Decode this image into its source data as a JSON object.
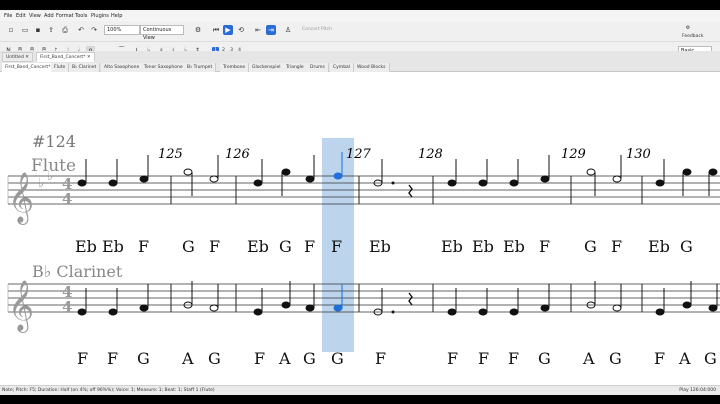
{
  "menu": [
    "File",
    "Edit",
    "View",
    "Add",
    "Format",
    "Tools",
    "Plugins",
    "Help"
  ],
  "toolbar": {
    "zoom_value": "100%",
    "view_mode": "Continuous View",
    "concert_pitch_label": "Concert Pitch",
    "feedback_label": "Feedback",
    "workspace_value": "Basic"
  },
  "voices": [
    "1",
    "2",
    "3",
    "4"
  ],
  "score_tabs": [
    "Untitled",
    "First_Band_Concert*"
  ],
  "part_tabs": [
    "First_Band_Concert*",
    "Flute",
    "B♭ Clarinet",
    "Alto Saxophone",
    "Tenor Saxophone",
    "B♭ Trumpet",
    "Trombone",
    "Glockenspiel",
    "Triangle",
    "Drums",
    "Cymbal",
    "Wood Blocks"
  ],
  "score": {
    "rehearsal": "#124",
    "measure_numbers": [
      "125",
      "126",
      "127",
      "128",
      "129",
      "130"
    ],
    "instruments": [
      {
        "name": "Flute",
        "time_top": "4",
        "time_bottom": "4",
        "lyrics": [
          "Eb",
          "Eb",
          "F",
          "G",
          "F",
          "Eb",
          "G",
          "F",
          "F",
          "Eb",
          "Eb",
          "Eb",
          "Eb",
          "F",
          "G",
          "F",
          "Eb",
          "G"
        ]
      },
      {
        "name": "B♭ Clarinet",
        "time_top": "4",
        "time_bottom": "4",
        "lyrics": [
          "F",
          "F",
          "G",
          "A",
          "G",
          "F",
          "A",
          "G",
          "G",
          "F",
          "F",
          "F",
          "F",
          "G",
          "A",
          "G",
          "F",
          "A",
          "G"
        ]
      }
    ]
  },
  "status": {
    "left": "Note; Pitch: F5; Duration: Half (on 4%; off 96%%); Voice: 1; Measure: 1; Beat: 1; Staff 1 (Flute)",
    "right": "Play 126:04:000"
  },
  "colors": {
    "accent": "#2b6bd6",
    "selection": "#bcd4ec",
    "selected_note": "#1e6fd9"
  }
}
